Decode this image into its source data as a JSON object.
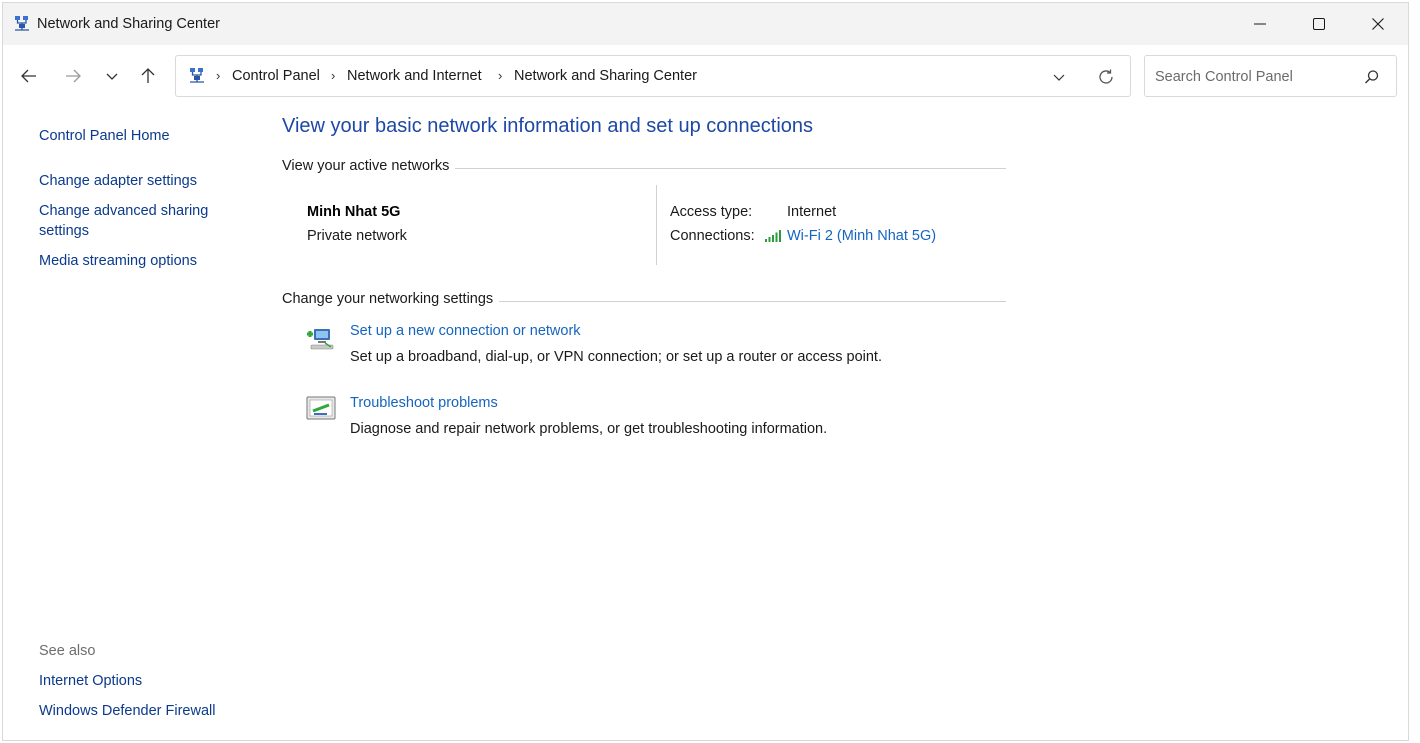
{
  "window": {
    "title": "Network and Sharing Center"
  },
  "address": {
    "crumbs": [
      "Control Panel",
      "Network and Internet",
      "Network and Sharing Center"
    ]
  },
  "search": {
    "placeholder": "Search Control Panel"
  },
  "sidebar": {
    "home": "Control Panel Home",
    "items": [
      "Change adapter settings",
      "Change advanced sharing settings",
      "Media streaming options"
    ],
    "see_also_title": "See also",
    "see_also": [
      "Internet Options",
      "Windows Defender Firewall"
    ]
  },
  "main": {
    "heading": "View your basic network information and set up connections",
    "active_networks_label": "View your active networks",
    "network": {
      "name": "Minh Nhat 5G",
      "category": "Private network",
      "access_type_label": "Access type:",
      "access_type_value": "Internet",
      "connections_label": "Connections:",
      "connection_value": "Wi-Fi 2 (Minh Nhat 5G)"
    },
    "change_settings_label": "Change your networking settings",
    "tasks": [
      {
        "icon": "new-connection-icon",
        "title": "Set up a new connection or network",
        "description": "Set up a broadband, dial-up, or VPN connection; or set up a router or access point."
      },
      {
        "icon": "troubleshoot-icon",
        "title": "Troubleshoot problems",
        "description": "Diagnose and repair network problems, or get troubleshooting information."
      }
    ]
  },
  "colors": {
    "link_dark": "#0b3a8c",
    "link_blue": "#1565c0",
    "heading_blue": "#1d48a6",
    "titlebar_bg": "#f3f3f3"
  }
}
